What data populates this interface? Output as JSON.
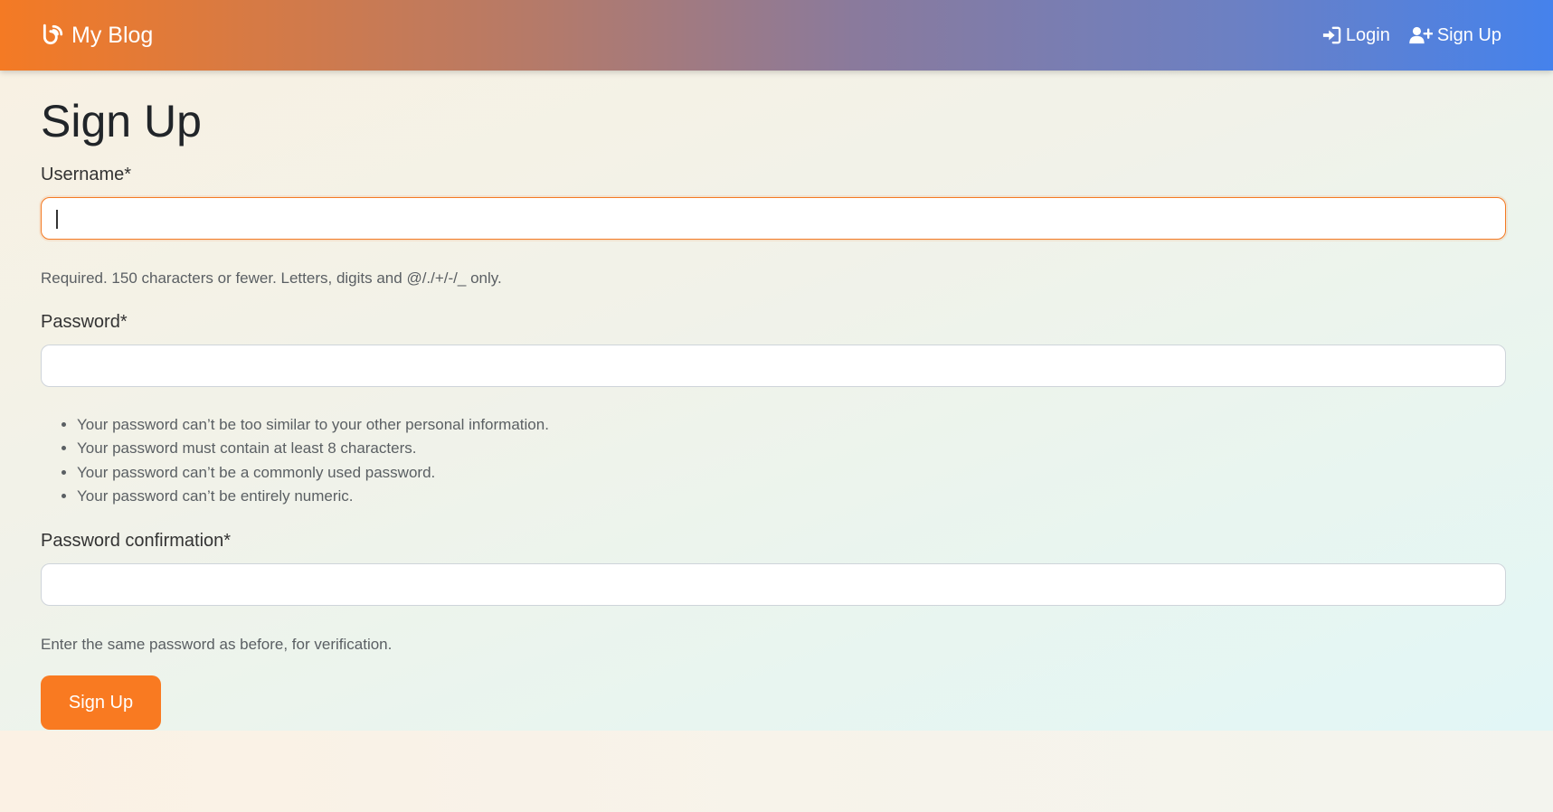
{
  "navbar": {
    "brand": "My Blog",
    "brand_icon": "blog-icon",
    "login_label": "Login",
    "signup_label": "Sign Up"
  },
  "page": {
    "title": "Sign Up"
  },
  "form": {
    "username": {
      "label": "Username*",
      "value": "",
      "help": "Required. 150 characters or fewer. Letters, digits and @/./+/-/_ only."
    },
    "password": {
      "label": "Password*",
      "value": "",
      "help": [
        "Your password can’t be too similar to your other personal information.",
        "Your password must contain at least 8 characters.",
        "Your password can’t be a commonly used password.",
        "Your password can’t be entirely numeric."
      ]
    },
    "password_confirmation": {
      "label": "Password confirmation*",
      "value": "",
      "help": "Enter the same password as before, for verification."
    },
    "submit_label": "Sign Up"
  },
  "colors": {
    "accent": "#f97a21",
    "nav_gradient_start": "#f47a24",
    "nav_gradient_end": "#4582ec"
  }
}
